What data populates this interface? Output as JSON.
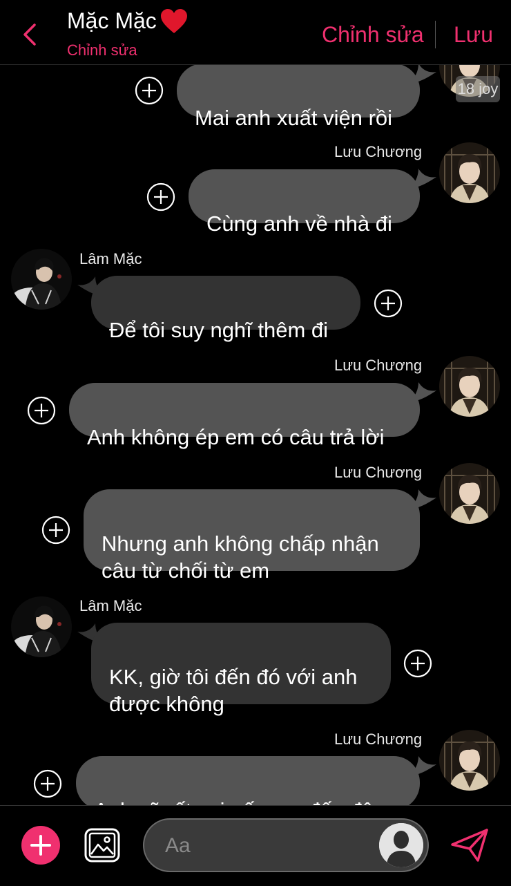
{
  "header": {
    "title": "Mặc Mặc",
    "subtitle": "Chỉnh sửa",
    "edit_label": "Chỉnh sửa",
    "save_label": "Lưu"
  },
  "colors": {
    "accent": "#f0306f",
    "bubble_outgoing": "#545454",
    "bubble_incoming": "#333333",
    "background": "#000000"
  },
  "watermark": "18 joy",
  "messages": [
    {
      "sender": "",
      "side": "right",
      "text": "Mai anh xuất viện rồi"
    },
    {
      "sender": "Lưu Chương",
      "side": "right",
      "text": "Cùng anh về nhà đi"
    },
    {
      "sender": "Lâm Mặc",
      "side": "left",
      "text": "Để tôi suy nghĩ thêm đi"
    },
    {
      "sender": "Lưu Chương",
      "side": "right",
      "text": "Anh không ép em có câu trả lời"
    },
    {
      "sender": "Lưu Chương",
      "side": "right",
      "text": "Nhưng anh không chấp nhận\ncâu từ chối từ em"
    },
    {
      "sender": "Lâm Mặc",
      "side": "left",
      "text": "KK, giờ tôi đến đó với anh\nđược không"
    },
    {
      "sender": "Lưu Chương",
      "side": "right",
      "text": "Anh sẽ rất vui nếu em đến đây"
    }
  ],
  "composer": {
    "placeholder": "Aa"
  },
  "icons": {
    "back": "chevron-left-icon",
    "heart": "heart-icon",
    "add": "plus-icon",
    "image": "image-icon",
    "send": "send-icon",
    "reaction": "circle-plus-icon"
  }
}
